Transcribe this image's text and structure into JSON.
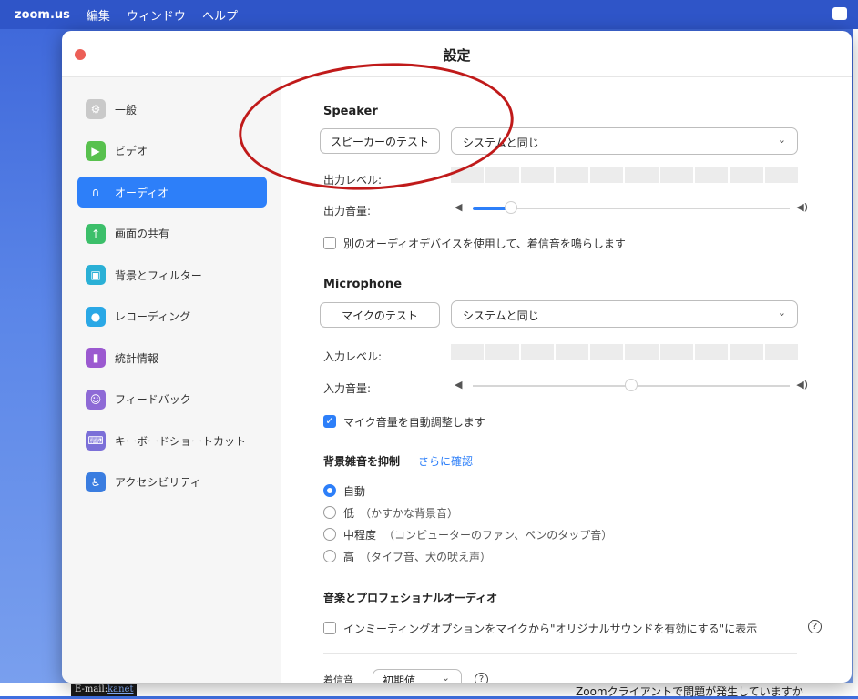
{
  "menubar": {
    "app": "zoom.us",
    "items": [
      "編集",
      "ウィンドウ",
      "ヘルプ"
    ]
  },
  "window": {
    "title": "設定"
  },
  "sidebar": {
    "items": [
      {
        "label": "一般",
        "icon": "gear-icon",
        "color": "#c9c9c9"
      },
      {
        "label": "ビデオ",
        "icon": "video-camera-icon",
        "color": "#58c14e"
      },
      {
        "label": "オーディオ",
        "icon": "headphones-icon",
        "color": "#2d7ff9",
        "active": true
      },
      {
        "label": "画面の共有",
        "icon": "share-screen-icon",
        "color": "#3cbf6a"
      },
      {
        "label": "背景とフィルター",
        "icon": "background-icon",
        "color": "#2ab0d6"
      },
      {
        "label": "レコーディング",
        "icon": "record-icon",
        "color": "#2aa8e6"
      },
      {
        "label": "統計情報",
        "icon": "statistics-icon",
        "color": "#9b59d0"
      },
      {
        "label": "フィードバック",
        "icon": "feedback-icon",
        "color": "#8e6ad6"
      },
      {
        "label": "キーボードショートカット",
        "icon": "keyboard-icon",
        "color": "#7b6fd8"
      },
      {
        "label": "アクセシビリティ",
        "icon": "accessibility-icon",
        "color": "#3a7de0"
      }
    ]
  },
  "speaker": {
    "heading": "Speaker",
    "test_button": "スピーカーのテスト",
    "device": "システムと同じ",
    "output_level_label": "出力レベル:",
    "output_volume_label": "出力音量:",
    "output_volume": 0.12,
    "separate_device_label": "別のオーディオデバイスを使用して、着信音を鳴らします"
  },
  "microphone": {
    "heading": "Microphone",
    "test_button": "マイクのテスト",
    "device": "システムと同じ",
    "input_level_label": "入力レベル:",
    "input_volume_label": "入力音量:",
    "input_volume": 0.5,
    "auto_adjust_label": "マイク音量を自動調整します"
  },
  "noise": {
    "heading": "背景雑音を抑制",
    "link": "さらに確認",
    "options": [
      {
        "label": "自動",
        "desc": "",
        "selected": true
      },
      {
        "label": "低",
        "desc": "（かすかな背景音）",
        "selected": false
      },
      {
        "label": "中程度",
        "desc": "（コンピューターのファン、ペンのタップ音）",
        "selected": false
      },
      {
        "label": "高",
        "desc": "（タイプ音、犬の吠え声）",
        "selected": false
      }
    ]
  },
  "music": {
    "heading": "音楽とプロフェショナルオーディオ",
    "original_sound_label": "インミーティングオプションをマイクから\"オリジナルサウンドを有効にする\"に表示"
  },
  "ringtone": {
    "label": "着信音",
    "value": "初期値"
  },
  "background": {
    "email_prefix": "E-mail:",
    "email_link": "kanet",
    "bottom_text": "Zoomクライアントで問題が発生していますか"
  },
  "colors": {
    "accent": "#2d7ff9",
    "annotation": "#c01a1a",
    "close": "#ec5f57"
  }
}
